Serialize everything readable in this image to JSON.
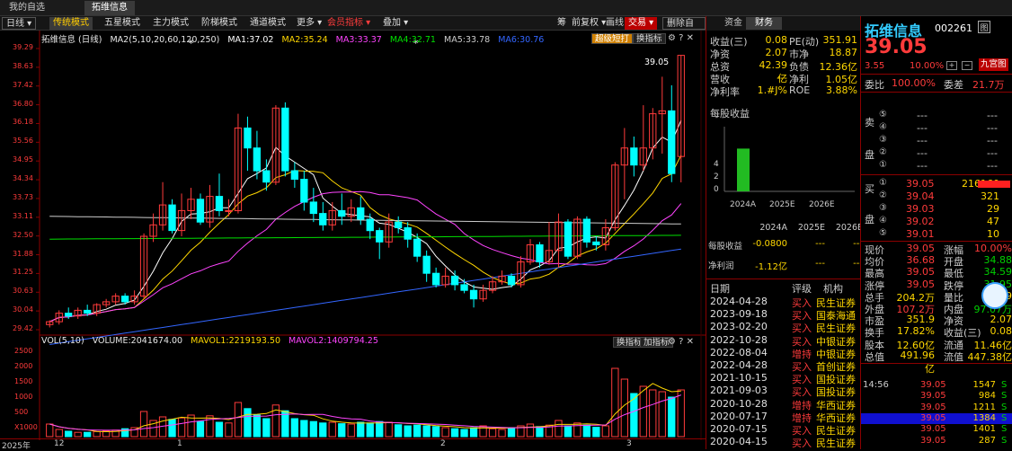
{
  "top_tabs": [
    "我的自选",
    "拓维信息"
  ],
  "toolbar": {
    "period": "日线",
    "modes": [
      "传统模式",
      "五星模式",
      "主力模式",
      "阶梯模式",
      "通道模式"
    ],
    "more": "更多",
    "member_indicators": "会员指标",
    "overlay": "叠加",
    "right_tools": [
      "筹",
      "前复权",
      "画线"
    ],
    "trade": "交易",
    "delete_watch": "删除自选"
  },
  "chart_header": {
    "name": "拓维信息 (日线)",
    "ma_label": "MA2(5,10,20,60,120,250)",
    "ma1": "MA1:37.02",
    "ma2": "MA2:35.24",
    "ma3": "MA3:33.37",
    "ma4": "MA4:32.71",
    "ma5": "MA5:33.78",
    "ma6": "MA6:30.76",
    "super_toptop": "超级短打",
    "switch_indicator": "换指标",
    "colors": {
      "ma1": "#ffffff",
      "ma2": "#ffd700",
      "ma3": "#ff44ff",
      "ma4": "#00e000",
      "ma5": "#cccccc",
      "ma6": "#3366ff"
    }
  },
  "price_axis": [
    "39.29",
    "38.63",
    "37.42",
    "36.80",
    "36.18",
    "35.56",
    "34.95",
    "34.34",
    "33.73",
    "33.11",
    "32.50",
    "31.88",
    "31.25",
    "30.63",
    "30.04",
    "29.42"
  ],
  "max_label": "39.05",
  "volume_header": {
    "vol": "VOL(5,10)",
    "volume": "VOLUME:2041674.00",
    "mavol1": "MAVOL1:2219193.50",
    "mavol2": "MAVOL2:1409794.25",
    "switch_indicator": "换指标",
    "add_indicator": "加指标"
  },
  "volume_axis": [
    "2500",
    "2000",
    "1500",
    "1000",
    "500",
    "X1000"
  ],
  "date_axis": [
    "2025年",
    "12",
    "1",
    "2",
    "3"
  ],
  "finance": {
    "tabs": [
      "资金",
      "财务"
    ],
    "rows": [
      {
        "l1": "收益(三)",
        "v1": "0.08",
        "l2": "PE(动)",
        "v2": "351.91"
      },
      {
        "l1": "净资",
        "v1": "2.07",
        "l2": "市净",
        "v2": "18.87"
      },
      {
        "l1": "总资",
        "v1": "42.39亿",
        "l2": "负债",
        "v2": "12.36亿"
      },
      {
        "l1": "营收",
        "v1": "---",
        "l2": "净利",
        "v2": "1.05亿"
      },
      {
        "l1": "净利率",
        "v1": "1.#J%",
        "l2": "ROE",
        "v2": "3.88%"
      }
    ],
    "eps_title": "每股收益",
    "eps_axis": [
      "4",
      "2",
      "0"
    ],
    "eps_years": [
      "2024A",
      "2025E",
      "2026E"
    ],
    "eps_value_2024A": 3.4,
    "eps_table": {
      "headers": [
        "2024A",
        "2025E",
        "2026E"
      ],
      "rows": [
        {
          "label": "每股收益",
          "values": [
            "-0.0800",
            "---",
            "---"
          ]
        },
        {
          "label": "净利润",
          "values": [
            "-1.12亿",
            "---",
            "---"
          ]
        }
      ]
    },
    "ratings": {
      "headers": [
        "日期",
        "评级",
        "机构"
      ],
      "rows": [
        [
          "2024-04-28",
          "买入",
          "民生证券"
        ],
        [
          "2023-09-18",
          "买入",
          "国泰海通"
        ],
        [
          "2023-02-20",
          "买入",
          "民生证券"
        ],
        [
          "2022-10-28",
          "买入",
          "中银证券"
        ],
        [
          "2022-08-04",
          "增持",
          "中银证券"
        ],
        [
          "2022-04-28",
          "买入",
          "首创证券"
        ],
        [
          "2021-10-15",
          "买入",
          "国投证券"
        ],
        [
          "2021-09-03",
          "买入",
          "国投证券"
        ],
        [
          "2020-10-28",
          "增持",
          "华西证券"
        ],
        [
          "2020-07-17",
          "增持",
          "华西证券"
        ],
        [
          "2020-07-15",
          "买入",
          "民生证券"
        ],
        [
          "2020-04-15",
          "买入",
          "民生证券"
        ]
      ]
    }
  },
  "quote": {
    "name": "拓维信息",
    "code": "002261",
    "code_icon": "图",
    "price": "39.05",
    "change": "3.55",
    "change_pct": "10.00%",
    "jiugong": "九宫图",
    "weibi_label": "委比",
    "weibi": "100.00%",
    "weicha_label": "委差",
    "weicha": "21.7万",
    "sell_label": [
      "卖",
      "盘"
    ],
    "buy_label": [
      "买",
      "盘"
    ],
    "sell": [
      {
        "n": "⑤",
        "p": "---",
        "v": "---"
      },
      {
        "n": "④",
        "p": "---",
        "v": "---"
      },
      {
        "n": "③",
        "p": "---",
        "v": "---"
      },
      {
        "n": "②",
        "p": "---",
        "v": "---"
      },
      {
        "n": "①",
        "p": "---",
        "v": "---"
      }
    ],
    "buy": [
      {
        "n": "①",
        "p": "39.05",
        "v": "216160"
      },
      {
        "n": "②",
        "p": "39.04",
        "v": "321"
      },
      {
        "n": "③",
        "p": "39.03",
        "v": "29"
      },
      {
        "n": "④",
        "p": "39.02",
        "v": "47"
      },
      {
        "n": "⑤",
        "p": "39.01",
        "v": "10"
      }
    ],
    "stats": [
      {
        "l1": "现价",
        "v1": "39.05",
        "l2": "涨幅",
        "v2": "10.00%"
      },
      {
        "l1": "均价",
        "v1": "36.68",
        "l2": "开盘",
        "v2": "34.88"
      },
      {
        "l1": "最高",
        "v1": "39.05",
        "l2": "最低",
        "v2": "34.59"
      },
      {
        "l1": "涨停",
        "v1": "39.05",
        "l2": "跌停",
        "v2": "31.95"
      },
      {
        "l1": "总手",
        "v1": "204.2万",
        "l2": "量比",
        "v2": "1.9"
      },
      {
        "l1": "外盘",
        "v1": "107.2万",
        "l2": "内盘",
        "v2": "97.07万"
      },
      {
        "l1": "市盈",
        "v1": "351.9",
        "l2": "净资",
        "v2": "2.07"
      },
      {
        "l1": "换手",
        "v1": "17.82%",
        "l2": "收益(三)",
        "v2": "0.08"
      },
      {
        "l1": "股本",
        "v1": "12.60亿",
        "l2": "流通",
        "v2": "11.46亿"
      },
      {
        "l1": "总值",
        "v1": "491.96亿",
        "l2": "流值",
        "v2": "447.38亿"
      }
    ],
    "ticks": [
      {
        "t": "14:56",
        "p": "39.05",
        "v": "1547",
        "s": "S"
      },
      {
        "t": "",
        "p": "39.05",
        "v": "984",
        "s": "S"
      },
      {
        "t": "",
        "p": "39.05",
        "v": "1211",
        "s": "S"
      },
      {
        "t": "",
        "p": "39.05",
        "v": "1384",
        "s": "S"
      },
      {
        "t": "",
        "p": "39.05",
        "v": "1401",
        "s": "S"
      },
      {
        "t": "",
        "p": "39.05",
        "v": "287",
        "s": "S"
      }
    ]
  },
  "chart_data": {
    "type": "candlestick",
    "price_range": [
      29.42,
      39.29
    ],
    "candles": [
      [
        29.6,
        29.7,
        29.5,
        29.75
      ],
      [
        29.7,
        30.0,
        29.6,
        30.1
      ],
      [
        30.0,
        29.9,
        29.8,
        30.2
      ],
      [
        29.9,
        30.1,
        29.8,
        30.2
      ],
      [
        30.1,
        30.0,
        29.9,
        30.3
      ],
      [
        30.0,
        30.3,
        29.9,
        30.35
      ],
      [
        30.3,
        30.4,
        30.2,
        30.5
      ],
      [
        30.4,
        30.6,
        30.3,
        30.7
      ],
      [
        30.6,
        30.4,
        30.3,
        30.7
      ],
      [
        30.4,
        30.6,
        30.3,
        30.8
      ],
      [
        30.6,
        32.7,
        30.5,
        32.8
      ],
      [
        32.7,
        33.1,
        32.5,
        33.5
      ],
      [
        33.1,
        33.8,
        32.9,
        34.6
      ],
      [
        33.8,
        32.9,
        32.8,
        34.0
      ],
      [
        32.9,
        33.6,
        32.7,
        34.2
      ],
      [
        33.6,
        34.0,
        33.3,
        34.4
      ],
      [
        34.0,
        33.2,
        33.1,
        34.2
      ],
      [
        33.2,
        34.1,
        33.0,
        34.5
      ],
      [
        34.1,
        33.6,
        33.4,
        34.9
      ],
      [
        33.6,
        33.6,
        33.4,
        34.0
      ],
      [
        33.6,
        36.5,
        33.5,
        37.0
      ],
      [
        36.5,
        35.8,
        35.0,
        36.9
      ],
      [
        35.8,
        35.0,
        34.7,
        36.4
      ],
      [
        35.0,
        34.6,
        34.3,
        35.4
      ],
      [
        34.6,
        37.2,
        34.5,
        37.3
      ],
      [
        37.2,
        35.0,
        34.8,
        37.4
      ],
      [
        35.0,
        34.7,
        34.4,
        35.3
      ],
      [
        34.7,
        33.9,
        33.6,
        35.0
      ],
      [
        33.9,
        33.5,
        33.2,
        34.4
      ],
      [
        33.5,
        33.1,
        32.9,
        33.9
      ],
      [
        33.1,
        33.6,
        32.9,
        33.9
      ],
      [
        33.6,
        33.4,
        33.1,
        34.2
      ],
      [
        33.4,
        33.7,
        33.2,
        34.0
      ],
      [
        33.7,
        33.3,
        33.1,
        34.1
      ],
      [
        33.3,
        32.9,
        32.6,
        33.5
      ],
      [
        32.9,
        32.5,
        31.9,
        33.0
      ],
      [
        32.5,
        33.2,
        32.3,
        33.5
      ],
      [
        33.2,
        33.0,
        32.8,
        33.4
      ],
      [
        33.0,
        32.6,
        32.3,
        33.2
      ],
      [
        32.6,
        32.0,
        31.8,
        32.8
      ],
      [
        32.0,
        31.4,
        31.1,
        32.2
      ],
      [
        31.4,
        31.0,
        30.9,
        31.6
      ],
      [
        31.0,
        31.3,
        30.9,
        31.6
      ],
      [
        31.3,
        31.0,
        30.8,
        31.5
      ],
      [
        31.0,
        30.8,
        30.7,
        31.2
      ],
      [
        30.8,
        30.5,
        30.2,
        31.0
      ],
      [
        30.5,
        30.8,
        30.4,
        31.0
      ],
      [
        30.8,
        31.1,
        30.7,
        31.3
      ],
      [
        31.1,
        31.3,
        31.0,
        31.5
      ],
      [
        31.3,
        31.0,
        30.9,
        31.4
      ],
      [
        31.0,
        31.8,
        30.9,
        32.0
      ],
      [
        31.8,
        32.4,
        31.7,
        32.6
      ],
      [
        32.4,
        31.8,
        31.6,
        32.5
      ],
      [
        31.8,
        32.2,
        31.7,
        33.2
      ],
      [
        32.2,
        33.2,
        31.6,
        33.5
      ],
      [
        33.2,
        32.0,
        31.9,
        33.3
      ],
      [
        32.0,
        33.3,
        31.9,
        33.4
      ],
      [
        33.3,
        32.5,
        32.3,
        33.4
      ],
      [
        32.5,
        32.4,
        32.2,
        32.7
      ],
      [
        32.4,
        33.0,
        32.2,
        33.3
      ],
      [
        33.0,
        35.2,
        32.9,
        35.3
      ],
      [
        35.2,
        35.8,
        34.0,
        36.5
      ],
      [
        35.8,
        35.2,
        34.8,
        36.2
      ],
      [
        35.2,
        35.8,
        35.0,
        37.3
      ],
      [
        35.8,
        37.0,
        35.4,
        37.2
      ],
      [
        37.0,
        37.1,
        35.6,
        38.3
      ],
      [
        37.1,
        34.9,
        34.6,
        38.0
      ],
      [
        35.5,
        39.05,
        34.59,
        39.05
      ]
    ],
    "volumes": [
      0.35,
      0.2,
      0.15,
      0.12,
      0.12,
      0.14,
      0.16,
      0.18,
      0.22,
      0.25,
      0.7,
      0.45,
      0.55,
      0.48,
      0.52,
      0.6,
      0.42,
      0.58,
      0.4,
      0.38,
      0.95,
      0.78,
      0.6,
      0.5,
      0.88,
      0.72,
      0.5,
      0.45,
      0.42,
      0.38,
      0.4,
      0.36,
      0.35,
      0.4,
      0.38,
      0.42,
      0.4,
      0.33,
      0.3,
      0.32,
      0.3,
      0.28,
      0.25,
      0.22,
      0.2,
      0.25,
      0.3,
      0.22,
      0.2,
      0.25,
      0.3,
      0.35,
      0.28,
      0.32,
      0.45,
      0.3,
      0.38,
      0.32,
      0.26,
      0.3,
      1.9,
      1.6,
      1.2,
      1.4,
      1.3,
      1.25,
      1.1,
      1.3
    ]
  }
}
